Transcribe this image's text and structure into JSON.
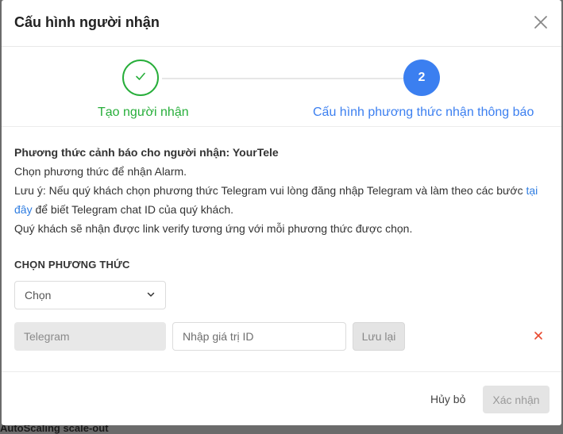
{
  "background": {
    "partial_text": "AutoScaling scale-out"
  },
  "modal": {
    "title": "Cấu hình người nhận"
  },
  "steps": [
    {
      "label": "Tạo người nhận",
      "state": "completed",
      "marker": "✓"
    },
    {
      "label": "Cấu hình phương thức nhận thông báo",
      "state": "active",
      "marker": "2"
    }
  ],
  "info": {
    "heading": "Phương thức cảnh báo cho người nhận: YourTele",
    "line1": "Chọn phương thức để nhận Alarm.",
    "note_before": "Lưu ý: Nếu quý khách chọn phương thức Telegram vui lòng đăng nhập Telegram và làm theo các bước ",
    "note_link": "tại đây",
    "note_after": " để biết Telegram chat ID của quý khách.",
    "line3": "Quý khách sẽ nhận được link verify tương ứng với mỗi phương thức được chọn."
  },
  "method_section": {
    "label": "CHỌN PHƯƠNG THỨC",
    "select_placeholder": "Chọn"
  },
  "method_row": {
    "method_value": "Telegram",
    "id_placeholder": "Nhập giá trị ID",
    "save_label": "Lưu lại"
  },
  "footer": {
    "cancel_label": "Hủy bỏ",
    "confirm_label": "Xác nhận"
  },
  "colors": {
    "success": "#27ae3a",
    "primary": "#3b7ff0",
    "danger": "#e8492f"
  }
}
